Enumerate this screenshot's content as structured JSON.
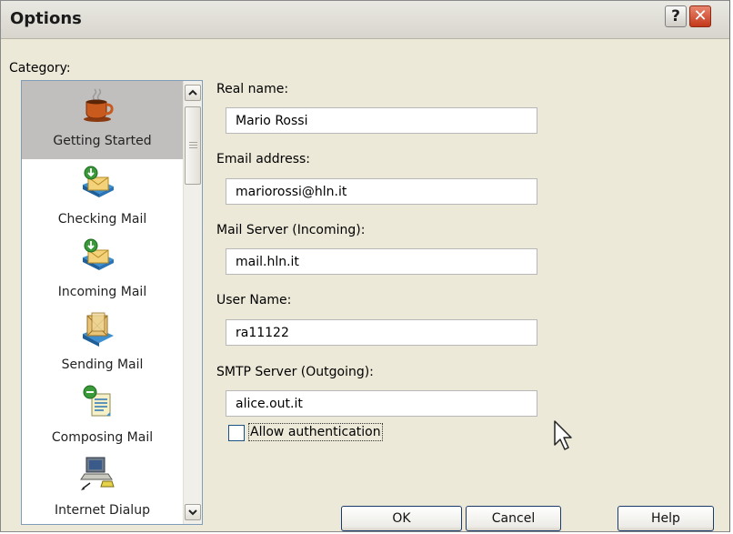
{
  "window": {
    "title": "Options"
  },
  "titlebar_buttons": {
    "help": "?",
    "close": "✕"
  },
  "category_label": "Category:",
  "categories": [
    {
      "label": "Getting Started",
      "icon": "coffee-cup-icon",
      "selected": true
    },
    {
      "label": "Checking Mail",
      "icon": "check-mail-icon"
    },
    {
      "label": "Incoming Mail",
      "icon": "incoming-mail-icon"
    },
    {
      "label": "Sending Mail",
      "icon": "sending-mail-icon"
    },
    {
      "label": "Composing Mail",
      "icon": "composing-mail-icon"
    },
    {
      "label": "Internet Dialup",
      "icon": "dialup-computer-icon"
    }
  ],
  "form": {
    "real_name": {
      "label": "Real name:",
      "value": "Mario Rossi"
    },
    "email": {
      "label": "Email address:",
      "value": "mariorossi@hln.it"
    },
    "incoming_server": {
      "label": "Mail Server (Incoming):",
      "value": "mail.hln.it"
    },
    "user_name": {
      "label": "User Name:",
      "value": "ra11122"
    },
    "smtp_server": {
      "label": "SMTP Server (Outgoing):",
      "value": "alice.out.it"
    },
    "allow_auth": {
      "label": "Allow authentication",
      "checked": false
    }
  },
  "buttons": {
    "ok": "OK",
    "cancel": "Cancel",
    "help": "Help"
  }
}
